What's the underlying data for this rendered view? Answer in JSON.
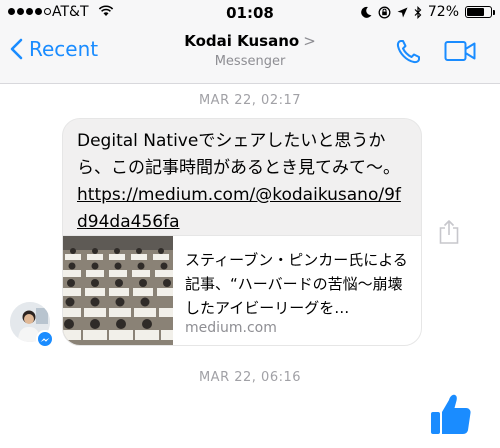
{
  "status_bar": {
    "carrier": "AT&T",
    "time": "01:08",
    "battery": "72%",
    "battery_level": 0.72
  },
  "nav": {
    "back_label": "Recent",
    "title": "Kodai Kusano",
    "title_chevron": ">",
    "subtitle": "Messenger",
    "accent_color": "#1a8cff"
  },
  "conversation": {
    "timestamp_1": "MAR 22, 02:17",
    "message_text": "Degital Nativeでシェアしたいと思うから、この記事時間があるとき見てみて〜。",
    "message_link": "https://medium.com/@kodaikusano/9fd94da456fa",
    "preview_title": "スティーブン・ピンカー氏による記事、“ハーバードの苦悩〜崩壊したアイビーリーグを…",
    "preview_domain": "medium.com",
    "timestamp_2": "MAR 22, 06:16"
  },
  "icons": {
    "back": "chevron-left-icon",
    "call": "phone-icon",
    "video": "video-camera-icon",
    "share": "share-icon",
    "like": "thumbs-up-icon",
    "badge": "messenger-badge-icon"
  }
}
